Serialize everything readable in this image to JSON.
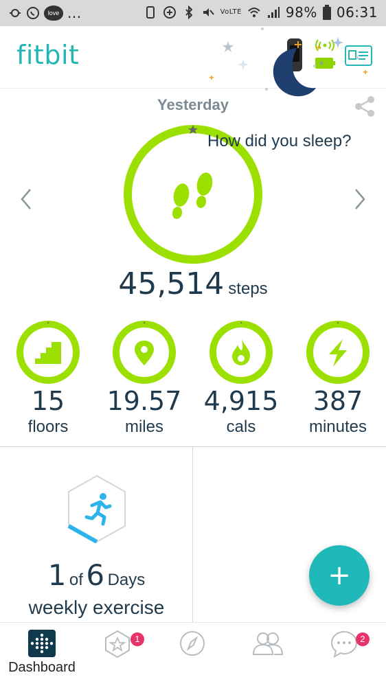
{
  "status_bar": {
    "battery_percent": "98%",
    "time": "06:31",
    "network": "VoLTE",
    "ellipsis": "...",
    "love_badge": "love"
  },
  "header": {
    "logo": "fitbit"
  },
  "summary": {
    "day_label": "Yesterday",
    "steps_value": "45,514",
    "steps_unit": "steps",
    "stats": [
      {
        "icon": "stairs-icon",
        "value": "15",
        "unit": "floors"
      },
      {
        "icon": "location-pin-icon",
        "value": "19.57",
        "unit": "miles"
      },
      {
        "icon": "flame-icon",
        "value": "4,915",
        "unit": "cals"
      },
      {
        "icon": "lightning-icon",
        "value": "387",
        "unit": "minutes"
      }
    ],
    "accent_color": "#9be000"
  },
  "cards": {
    "exercise": {
      "count": "1",
      "of": "of",
      "total": "6",
      "days": "Days",
      "label": "weekly exercise"
    },
    "sleep": {
      "prompt": "How did you sleep?"
    }
  },
  "fab": {
    "label": "+"
  },
  "bottom_nav": {
    "items": [
      {
        "label": "Dashboard",
        "icon": "dashboard-icon",
        "active": true
      },
      {
        "label": "",
        "icon": "challenges-star-icon",
        "badge": "1"
      },
      {
        "label": "",
        "icon": "discover-compass-icon"
      },
      {
        "label": "",
        "icon": "community-friends-icon"
      },
      {
        "label": "",
        "icon": "messages-chat-icon",
        "badge": "2"
      }
    ]
  }
}
